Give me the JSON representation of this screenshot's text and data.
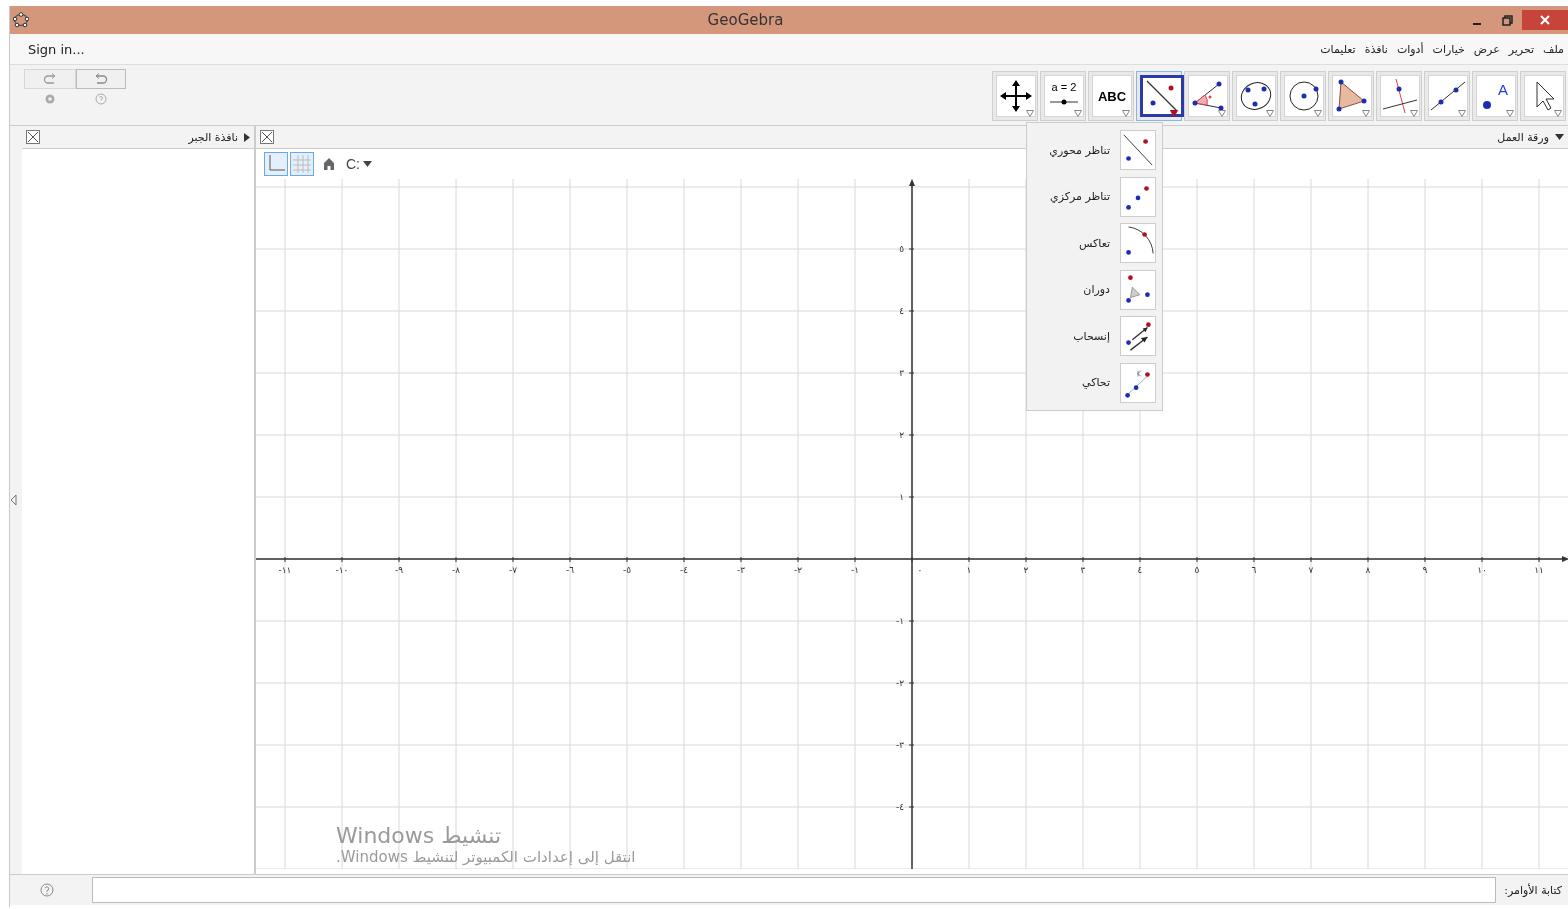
{
  "window": {
    "title": "GeoGebra"
  },
  "menu": {
    "sign_in": "Sign in...",
    "items": [
      "ملف",
      "تحرير",
      "عرض",
      "خيارات",
      "أدوات",
      "نافذة",
      "تعليمات"
    ]
  },
  "tools": [
    {
      "kind": "move-view",
      "selected": false
    },
    {
      "kind": "slider",
      "label": "a = 2",
      "selected": false
    },
    {
      "kind": "text",
      "label": "ABC",
      "selected": false
    },
    {
      "kind": "reflect",
      "selected": true
    },
    {
      "kind": "angle",
      "selected": false
    },
    {
      "kind": "conic",
      "selected": false
    },
    {
      "kind": "circle",
      "selected": false
    },
    {
      "kind": "polygon",
      "selected": false
    },
    {
      "kind": "perpendicular",
      "selected": false
    },
    {
      "kind": "line",
      "selected": false
    },
    {
      "kind": "point",
      "label": "A",
      "selected": false
    },
    {
      "kind": "pointer",
      "selected": false
    }
  ],
  "dropdown": [
    {
      "kind": "reflect-line",
      "label": "تناظر محوري"
    },
    {
      "kind": "reflect-point",
      "label": "تناظر مركزي"
    },
    {
      "kind": "invert",
      "label": "تعاكس"
    },
    {
      "kind": "rotate",
      "label": "دوران"
    },
    {
      "kind": "translate",
      "label": "إنسحاب"
    },
    {
      "kind": "dilate",
      "label": "تحاكي"
    }
  ],
  "algebra_view": {
    "title": "نافذة الجبر"
  },
  "graphics_view": {
    "title": "ورقة العمل",
    "style_bar": {
      "axes_on": true,
      "grid_on": true,
      "point_capture": "C:"
    },
    "x_labels": [
      "١١",
      "١٠",
      "٩",
      "٨",
      "٧",
      "٦",
      "٥",
      "٤",
      "٣",
      "٢",
      "١",
      "٠",
      "-١",
      "-٢",
      "-٣",
      "-٤",
      "-٥",
      "-٦",
      "-٧",
      "-٨",
      "-٩",
      "-١٠",
      "-١١"
    ],
    "y_labels": [
      "٥",
      "٤",
      "٣",
      "٢",
      "١",
      "-١",
      "-٢",
      "-٣",
      "-٤"
    ]
  },
  "activation_notice": {
    "title": "تنشيط Windows",
    "text": "انتقل إلى إعدادات الكمبيوتر لتنشيط Windows."
  },
  "input_bar": {
    "label": "كتابة الأوامر:"
  }
}
